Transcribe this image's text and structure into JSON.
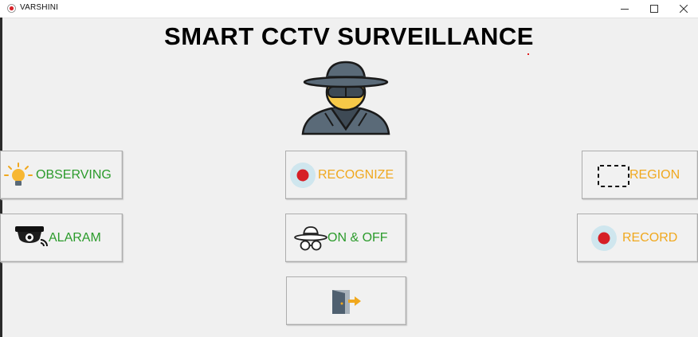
{
  "window": {
    "title": "VARSHINI",
    "controls": [
      "minimize",
      "maximize",
      "close"
    ]
  },
  "heading": "SMART CCTV SURVEILLANCE",
  "buttons": {
    "observing": {
      "label": "OBSERVING",
      "icon": "bulb-icon",
      "color": "#2b9b2b"
    },
    "recognize": {
      "label": "RECOGNIZE",
      "icon": "record-dot-icon",
      "color": "#f0a81e"
    },
    "region": {
      "label": "REGION",
      "icon": "dashed-rectangle-icon",
      "color": "#f0a81e"
    },
    "alaram": {
      "label": "ALARAM",
      "icon": "cctv-camera-icon",
      "color": "#2b9b2b"
    },
    "on_off": {
      "label": "ON & OFF",
      "icon": "spy-icon",
      "color": "#2b9b2b"
    },
    "record": {
      "label": "RECORD",
      "icon": "record-dot-icon",
      "color": "#f0a81e"
    },
    "exit": {
      "label": "",
      "icon": "exit-door-icon"
    }
  }
}
